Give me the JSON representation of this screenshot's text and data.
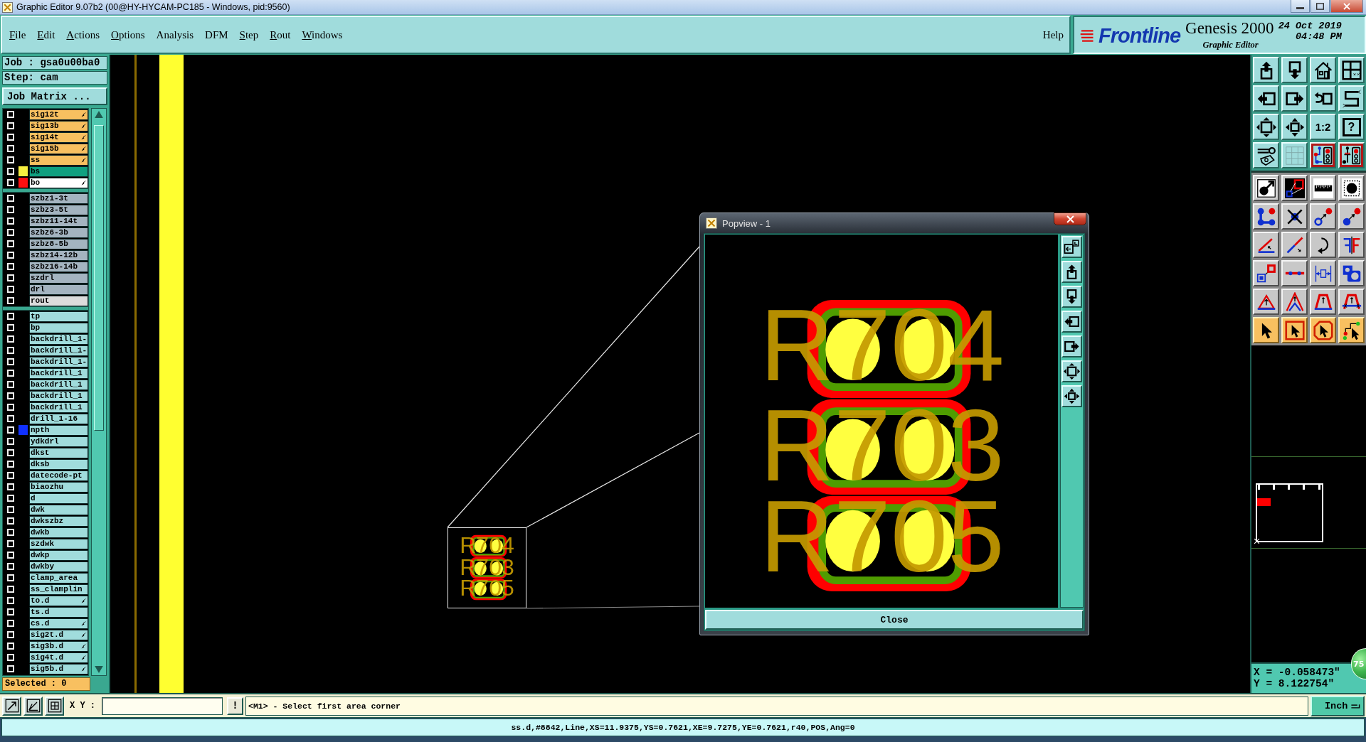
{
  "window": {
    "title": "Graphic Editor 9.07b2 (00@HY-HYCAM-PC185 - Windows, pid:9560)"
  },
  "menu": {
    "items": [
      {
        "label": "File",
        "mnemonic": true
      },
      {
        "label": "Edit",
        "mnemonic": true
      },
      {
        "label": "Actions",
        "mnemonic": true
      },
      {
        "label": "Options",
        "mnemonic": true
      },
      {
        "label": "Analysis",
        "mnemonic": false
      },
      {
        "label": "DFM",
        "mnemonic": false
      },
      {
        "label": "Step",
        "mnemonic": true
      },
      {
        "label": "Rout",
        "mnemonic": true
      },
      {
        "label": "Windows",
        "mnemonic": true
      }
    ],
    "help": {
      "label": "Help",
      "mnemonic": false
    }
  },
  "brand": {
    "logo": "Frontline",
    "product": "Genesis 2000",
    "subtitle": "Graphic Editor",
    "date": "24 Oct 2019",
    "time": "04:48 PM"
  },
  "job_panel": {
    "job": "Job : gsa0u00ba0",
    "step": "Step: cam",
    "matrix_button": "Job Matrix ...",
    "layer_groups": [
      {
        "layers": [
          {
            "name": "sig12t",
            "kind": "board",
            "checked": false,
            "affected": true
          },
          {
            "name": "sig13b",
            "kind": "board",
            "checked": false,
            "affected": true
          },
          {
            "name": "sig14t",
            "kind": "board",
            "checked": false,
            "affected": true
          },
          {
            "name": "sig15b",
            "kind": "board",
            "checked": false,
            "affected": true
          },
          {
            "name": "ss",
            "kind": "board",
            "checked": false,
            "affected": true
          },
          {
            "name": "bs",
            "kind": "mask",
            "checked": false,
            "affected": false,
            "color": "#f8f040"
          },
          {
            "name": "bo",
            "kind": "work",
            "checked": false,
            "affected": true,
            "color": "#ff1010"
          }
        ]
      },
      {
        "layers": [
          {
            "name": "szbz1-3t",
            "kind": "drill",
            "checked": false,
            "affected": false
          },
          {
            "name": "szbz3-5t",
            "kind": "drill",
            "checked": false,
            "affected": false
          },
          {
            "name": "szbz11-14t",
            "kind": "drill",
            "checked": false,
            "affected": false
          },
          {
            "name": "szbz6-3b",
            "kind": "drill",
            "checked": false,
            "affected": false
          },
          {
            "name": "szbz8-5b",
            "kind": "drill",
            "checked": false,
            "affected": false
          },
          {
            "name": "szbz14-12b",
            "kind": "drill",
            "checked": false,
            "affected": false
          },
          {
            "name": "szbz16-14b",
            "kind": "drill",
            "checked": false,
            "affected": false
          },
          {
            "name": "szdrl",
            "kind": "drill",
            "checked": false,
            "affected": false
          },
          {
            "name": "drl",
            "kind": "drill",
            "checked": false,
            "affected": false
          },
          {
            "name": "rout",
            "kind": "rout",
            "checked": false,
            "affected": false
          }
        ]
      },
      {
        "layers": [
          {
            "name": "tp",
            "kind": "misc",
            "checked": false,
            "affected": false
          },
          {
            "name": "bp",
            "kind": "misc",
            "checked": false,
            "affected": false
          },
          {
            "name": "backdrill_1-",
            "kind": "misc",
            "checked": false,
            "affected": false
          },
          {
            "name": "backdrill_1-",
            "kind": "misc",
            "checked": false,
            "affected": false
          },
          {
            "name": "backdrill_1-",
            "kind": "misc",
            "checked": false,
            "affected": false
          },
          {
            "name": "backdrill_1",
            "kind": "misc",
            "checked": false,
            "affected": false
          },
          {
            "name": "backdrill_1",
            "kind": "misc",
            "checked": false,
            "affected": false
          },
          {
            "name": "backdrill_1",
            "kind": "misc",
            "checked": false,
            "affected": false
          },
          {
            "name": "backdrill_1",
            "kind": "misc",
            "checked": false,
            "affected": false
          },
          {
            "name": "drill_1-16",
            "kind": "misc",
            "checked": false,
            "affected": false
          },
          {
            "name": "npth",
            "kind": "misc",
            "checked": false,
            "affected": false,
            "color": "#1030ff"
          },
          {
            "name": "ydkdrl",
            "kind": "misc",
            "checked": false,
            "affected": false
          },
          {
            "name": "dkst",
            "kind": "misc",
            "checked": false,
            "affected": false
          },
          {
            "name": "dksb",
            "kind": "misc",
            "checked": false,
            "affected": false
          },
          {
            "name": "datecode-pt",
            "kind": "misc",
            "checked": false,
            "affected": false
          },
          {
            "name": "biaozhu",
            "kind": "misc",
            "checked": false,
            "affected": false
          },
          {
            "name": "d",
            "kind": "misc",
            "checked": false,
            "affected": false
          },
          {
            "name": "dwk",
            "kind": "misc",
            "checked": false,
            "affected": false
          },
          {
            "name": "dwkszbz",
            "kind": "misc",
            "checked": false,
            "affected": false
          },
          {
            "name": "dwkb",
            "kind": "misc",
            "checked": false,
            "affected": false
          },
          {
            "name": "szdwk",
            "kind": "misc",
            "checked": false,
            "affected": false
          },
          {
            "name": "dwkp",
            "kind": "misc",
            "checked": false,
            "affected": false
          },
          {
            "name": "dwkby",
            "kind": "misc",
            "checked": false,
            "affected": false
          },
          {
            "name": "clamp_area",
            "kind": "misc",
            "checked": false,
            "affected": false
          },
          {
            "name": "ss_clamplin",
            "kind": "misc",
            "checked": false,
            "affected": false
          },
          {
            "name": "to.d",
            "kind": "misc",
            "checked": false,
            "affected": true
          },
          {
            "name": "ts.d",
            "kind": "misc",
            "checked": false,
            "affected": false
          },
          {
            "name": "cs.d",
            "kind": "misc",
            "checked": false,
            "affected": true
          },
          {
            "name": "sig2t.d",
            "kind": "misc",
            "checked": false,
            "affected": true
          },
          {
            "name": "sig3b.d",
            "kind": "misc",
            "checked": false,
            "affected": true
          },
          {
            "name": "sig4t.d",
            "kind": "misc",
            "checked": false,
            "affected": true
          },
          {
            "name": "sig5b.d",
            "kind": "misc",
            "checked": false,
            "affected": true
          }
        ]
      }
    ],
    "selected_count": "Selected : 0"
  },
  "canvas": {
    "thumbnail_labels": [
      "R704",
      "R703",
      "R705"
    ]
  },
  "popview": {
    "title": "Popview - 1",
    "labels": [
      "R704",
      "R703",
      "R705"
    ],
    "tools": [
      {
        "kind": "boxes-arrow"
      },
      {
        "kind": "box-up"
      },
      {
        "kind": "box-down"
      },
      {
        "kind": "box-left"
      },
      {
        "kind": "box-right"
      },
      {
        "kind": "expand"
      },
      {
        "kind": "compact"
      }
    ],
    "close_button": "Close"
  },
  "toolbar": {
    "sections": [
      {
        "buttons": [
          {
            "kind": "box-up",
            "active": false
          },
          {
            "kind": "box-down",
            "active": false
          },
          {
            "kind": "house",
            "active": false
          },
          {
            "kind": "window-grid",
            "active": false
          },
          {
            "kind": "box-left",
            "active": false
          },
          {
            "kind": "box-right",
            "active": false
          },
          {
            "kind": "return-box",
            "active": false
          },
          {
            "kind": "s-path",
            "active": false
          },
          {
            "kind": "expand",
            "active": false
          },
          {
            "kind": "compact",
            "active": false
          },
          {
            "kind": "label",
            "label": "1:2",
            "active": false
          },
          {
            "kind": "framed-label",
            "label": "?",
            "active": false
          },
          {
            "kind": "wrench",
            "active": false
          },
          {
            "kind": "grid",
            "active": false
          },
          {
            "kind": "circuit-lights",
            "active": true
          },
          {
            "kind": "circuit-lights-alt",
            "active": true
          }
        ]
      },
      {
        "buttons": [
          {
            "kind": "dot-arrow",
            "active": false
          },
          {
            "kind": "squares-link",
            "active": false
          },
          {
            "kind": "ruler",
            "active": false
          },
          {
            "kind": "dot-frame",
            "active": false
          },
          {
            "kind": "nodes",
            "active": false
          },
          {
            "kind": "cross-dot",
            "active": false
          },
          {
            "kind": "ring-to-dot",
            "active": false
          },
          {
            "kind": "dot-to-dot",
            "active": false
          },
          {
            "kind": "angle-line",
            "active": false
          },
          {
            "kind": "diagonal",
            "active": false
          },
          {
            "kind": "curve-arrow",
            "active": false
          },
          {
            "kind": "mirror",
            "active": false
          },
          {
            "kind": "squares-arrow",
            "active": false
          },
          {
            "kind": "segment",
            "active": false
          },
          {
            "kind": "dimension",
            "active": false
          },
          {
            "kind": "holes",
            "active": false
          },
          {
            "kind": "triangle",
            "active": false
          },
          {
            "kind": "peak",
            "active": false
          },
          {
            "kind": "arch",
            "active": false
          },
          {
            "kind": "arch-cross",
            "active": false
          }
        ]
      },
      {
        "buttons": [
          {
            "kind": "pointer",
            "active": false
          },
          {
            "kind": "pointer-square",
            "active": false
          },
          {
            "kind": "pointer-octagon",
            "active": false
          },
          {
            "kind": "pointer-path",
            "active": false
          }
        ]
      }
    ]
  },
  "coordinates": {
    "x": "X = -0.058473\"",
    "y": "Y = 8.122754\""
  },
  "floating_badge": {
    "text": "75"
  },
  "command_bar": {
    "tools": [
      {
        "kind": "frame-arrow"
      },
      {
        "kind": "frame-angle"
      },
      {
        "kind": "frame-grid"
      }
    ],
    "xy_label": "X Y :",
    "prompt_button": "!",
    "message": "<M1> - Select first area corner",
    "units": "Inch"
  },
  "status_line": "ss.d,#8842,Line,XS=11.9375,YS=0.7621,XE=9.7275,YE=0.7621,r40,POS,Ang=0"
}
